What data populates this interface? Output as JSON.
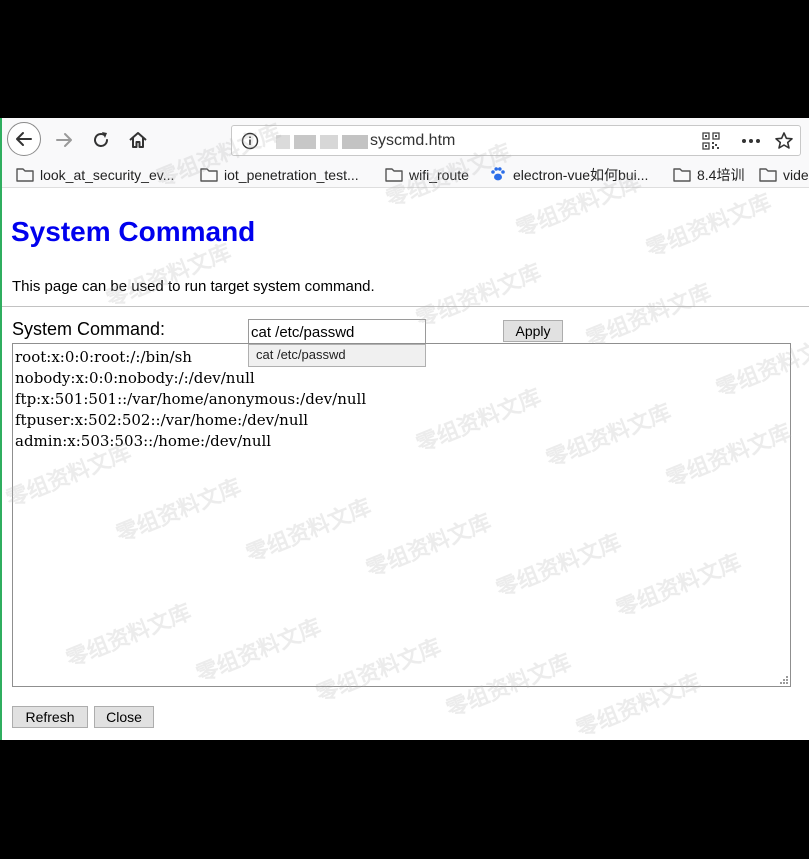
{
  "browser": {
    "url_text": "syscmd.htm",
    "bookmarks": [
      "look_at_security_ev...",
      "iot_penetration_test...",
      "wifi_route",
      "electron-vue如何bui...",
      "8.4培训",
      "vide"
    ]
  },
  "page": {
    "title": "System Command",
    "description": "This page can be used to run target system command.",
    "command_label": "System Command:",
    "command_value": "cat /etc/passwd",
    "suggestion": "cat /etc/passwd",
    "apply_label": "Apply",
    "output_lines": [
      "root:x:0:0:root:/:/bin/sh",
      "nobody:x:0:0:nobody:/:/dev/null",
      "ftp:x:501:501::/var/home/anonymous:/dev/null",
      "ftpuser:x:502:502::/var/home:/dev/null",
      "admin:x:503:503::/home:/dev/null"
    ],
    "refresh_label": "Refresh",
    "close_label": "Close"
  },
  "watermark_text": "零组资料文库",
  "icons": {
    "back": "back-arrow-icon",
    "forward": "forward-arrow-icon",
    "reload": "reload-icon",
    "home": "home-icon",
    "info": "info-icon",
    "qr": "qr-code-icon",
    "more": "more-dots-icon",
    "star": "star-icon",
    "folder": "folder-icon",
    "paw": "baidu-paw-icon"
  },
  "colors": {
    "title": "#0000ee",
    "accent_border": "#2fae5f"
  }
}
